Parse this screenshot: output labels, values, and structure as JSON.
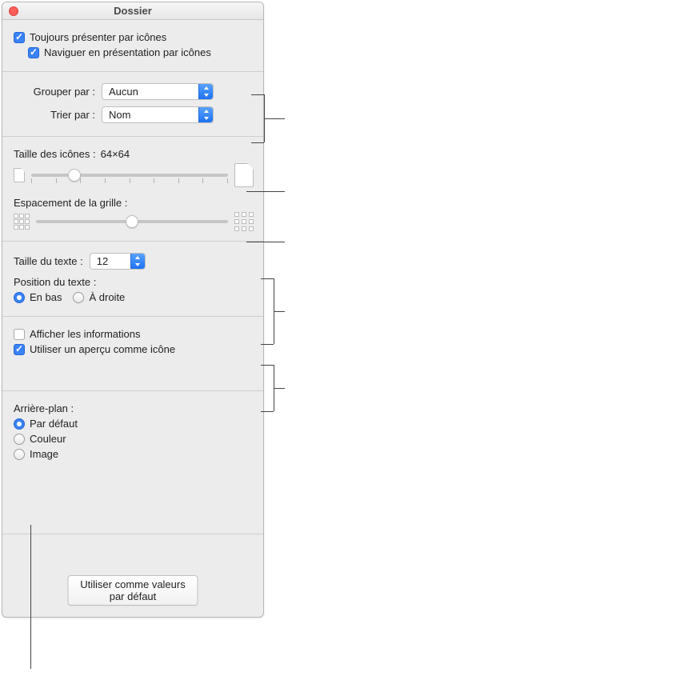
{
  "window": {
    "title": "Dossier"
  },
  "general": {
    "always_icon_view_label": "Toujours présenter par icônes",
    "always_icon_view_checked": true,
    "browse_icon_view_label": "Naviguer en présentation par icônes",
    "browse_icon_view_checked": true
  },
  "arrange": {
    "group_by_label": "Grouper par :",
    "group_by_value": "Aucun",
    "sort_by_label": "Trier par :",
    "sort_by_value": "Nom"
  },
  "icon": {
    "icon_size_label": "Taille des icônes :",
    "icon_size_value": "64×64",
    "icon_size_slider_percent": 22,
    "grid_spacing_label": "Espacement de la grille :",
    "grid_spacing_slider_percent": 50
  },
  "text": {
    "text_size_label": "Taille du texte :",
    "text_size_value": "12",
    "label_position_label": "Position du texte :",
    "pos_bottom_label": "En bas",
    "pos_right_label": "À droite",
    "pos_bottom_selected": true,
    "pos_right_selected": false
  },
  "info": {
    "show_info_label": "Afficher les informations",
    "show_info_checked": false,
    "preview_as_icon_label": "Utiliser un aperçu comme icône",
    "preview_as_icon_checked": true
  },
  "background": {
    "heading": "Arrière-plan :",
    "default_label": "Par défaut",
    "color_label": "Couleur",
    "image_label": "Image",
    "default_selected": true,
    "color_selected": false,
    "image_selected": false
  },
  "footer": {
    "use_as_default_label": "Utiliser comme valeurs par défaut"
  }
}
